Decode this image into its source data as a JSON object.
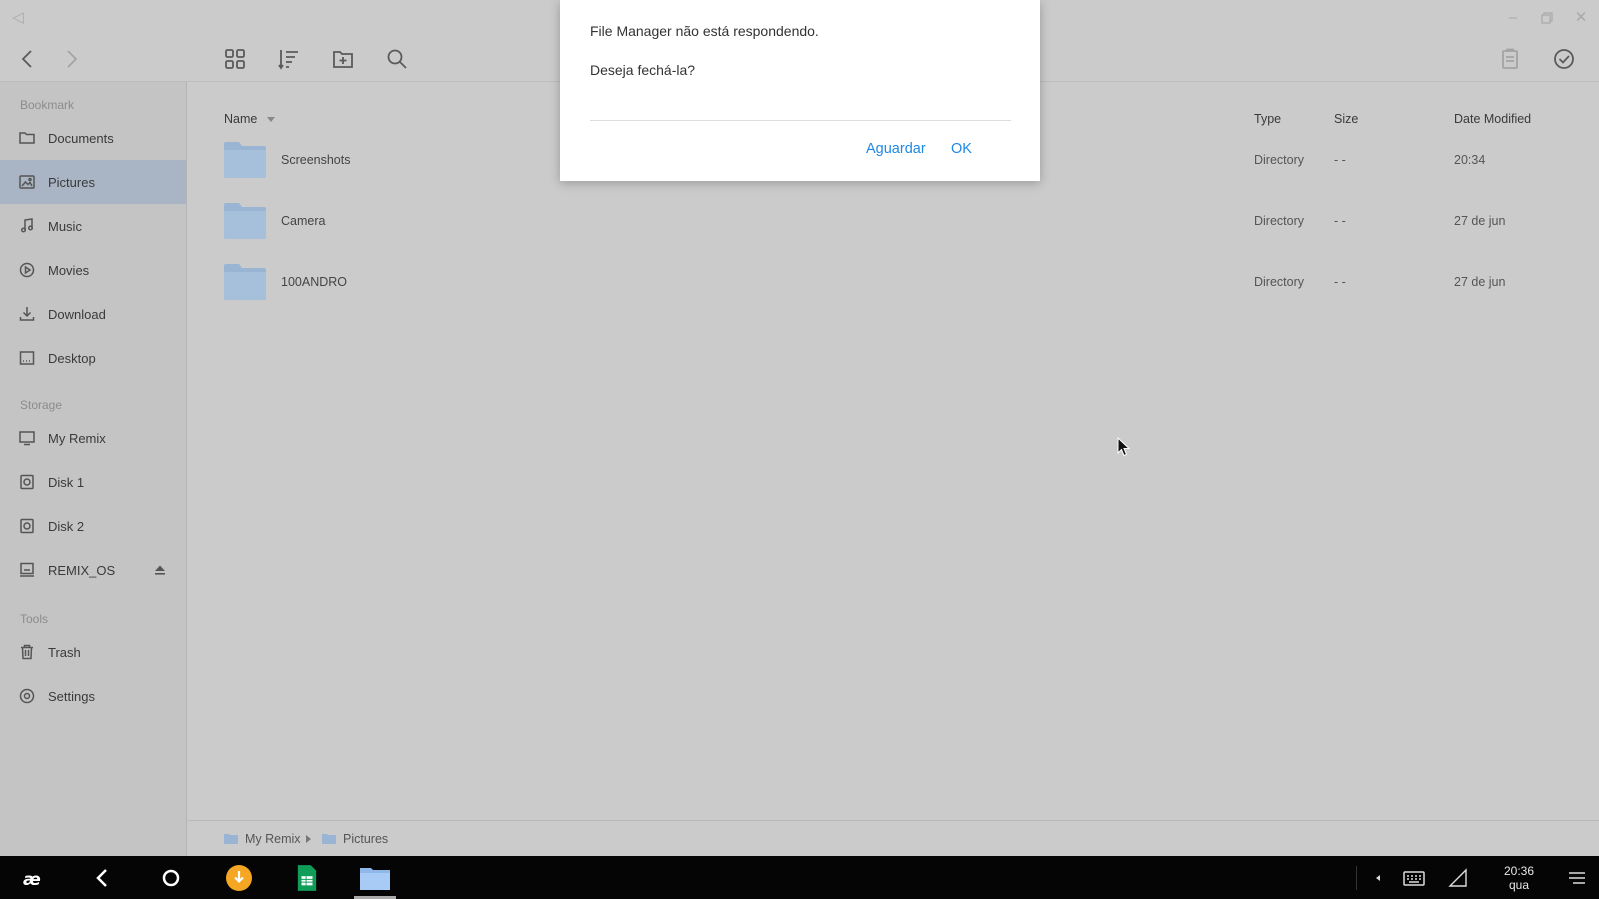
{
  "sidebar": {
    "sections": [
      {
        "label": "Bookmark"
      },
      {
        "label": "Storage"
      },
      {
        "label": "Tools"
      }
    ],
    "items": [
      {
        "label": "Documents",
        "icon": "folder-icon"
      },
      {
        "label": "Pictures",
        "icon": "image-icon"
      },
      {
        "label": "Music",
        "icon": "music-note-icon"
      },
      {
        "label": "Movies",
        "icon": "play-circle-icon"
      },
      {
        "label": "Download",
        "icon": "download-icon"
      },
      {
        "label": "Desktop",
        "icon": "desktop-icon"
      },
      {
        "label": "My Remix",
        "icon": "monitor-icon"
      },
      {
        "label": "Disk 1",
        "icon": "disk-icon"
      },
      {
        "label": "Disk 2",
        "icon": "disk-icon"
      },
      {
        "label": "REMIX_OS",
        "icon": "drive-icon"
      },
      {
        "label": "Trash",
        "icon": "trash-icon"
      },
      {
        "label": "Settings",
        "icon": "gear-icon"
      }
    ],
    "active": "Pictures"
  },
  "columns": {
    "name": "Name",
    "type": "Type",
    "size": "Size",
    "date": "Date Modified"
  },
  "files": [
    {
      "name": "Screenshots",
      "type": "Directory",
      "size": "- -",
      "date": "20:34"
    },
    {
      "name": "Camera",
      "type": "Directory",
      "size": "- -",
      "date": "27 de jun"
    },
    {
      "name": "100ANDRO",
      "type": "Directory",
      "size": "- -",
      "date": "27 de jun"
    }
  ],
  "breadcrumb": [
    "My Remix",
    "Pictures"
  ],
  "dialog": {
    "title": "File Manager não está respondendo.",
    "message": "Deseja fechá-la?",
    "wait_label": "Aguardar",
    "ok_label": "OK"
  },
  "taskbar": {
    "time": "20:36",
    "day": "qua"
  },
  "colors": {
    "accent": "#1e88e5",
    "folder": "#9ab4d3",
    "active_item": "#a9b5c4",
    "taskbar": "#050505"
  }
}
